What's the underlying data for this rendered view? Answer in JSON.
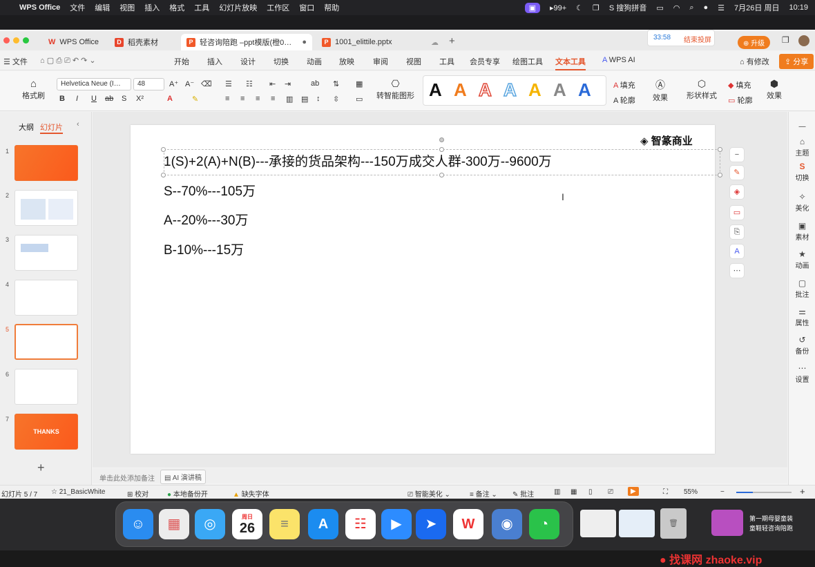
{
  "menubar": {
    "app": "WPS Office",
    "items": [
      "文件",
      "编辑",
      "视图",
      "插入",
      "格式",
      "工具",
      "幻灯片放映",
      "工作区",
      "窗口",
      "帮助"
    ],
    "badge": "99+",
    "ime": "搜狗拼音",
    "date": "7月26日 周日",
    "time": "10:19"
  },
  "tabs": [
    {
      "label": "WPS Office"
    },
    {
      "label": "稻壳素材"
    },
    {
      "label": "轻咨询陪跑 –ppt模版(橙0…"
    },
    {
      "label": "1001_elittile.pptx"
    }
  ],
  "record": {
    "time": "33:58",
    "stop": "结束投屏"
  },
  "upgrade": "升级",
  "ribbon_tabs": {
    "file": "文件",
    "items": [
      "开始",
      "插入",
      "设计",
      "切换",
      "动画",
      "放映",
      "审阅",
      "视图",
      "工具",
      "会员专享",
      "绘图工具",
      "文本工具",
      "WPS AI"
    ],
    "active": "文本工具",
    "modify": "有修改",
    "share": "分享"
  },
  "ribbon": {
    "format_painter": "格式刷",
    "font": "Helvetica Neue (I…",
    "size": "48",
    "smart": "转智能图形",
    "fill": "填充",
    "outline": "轮廓",
    "effect": "效果",
    "shape_style": "形状样式",
    "fill2": "填充",
    "outline2": "轮廓",
    "effect2": "效果"
  },
  "left_panel": {
    "outline": "大纲",
    "slides": "幻灯片",
    "thumbs": [
      "1",
      "2",
      "3",
      "4",
      "5",
      "6",
      "7"
    ],
    "thanks": "THANKS"
  },
  "slide": {
    "logo": "智篆商业",
    "lines": [
      "1(S)+2(A)+N(B)---承接的货品架构---150万成交人群-300万--9600万",
      "S--70%---105万",
      "A--20%---30万",
      "B-10%---15万"
    ]
  },
  "right_panel": [
    "主题",
    "切换",
    "美化",
    "素材",
    "动画",
    "批注",
    "属性",
    "备份",
    "设置"
  ],
  "notes": {
    "placeholder": "单击此处添加备注",
    "ai": "AI 演讲稿"
  },
  "status": {
    "slide": "幻灯片 5 / 7",
    "theme": "21_BasicWhite",
    "proof": "校对",
    "backup": "本地备份开",
    "missing": "缺失字体",
    "beautify": "智能美化",
    "notes": "备注",
    "comment": "批注",
    "zoom": "55%"
  },
  "dock": {
    "calendar_month": "周日",
    "calendar_day": "26",
    "folder_text1": "第一期母婴童装",
    "folder_text2": "童鞋轻咨询陪跑"
  },
  "watermark": "找课网 zhaoke.vip"
}
